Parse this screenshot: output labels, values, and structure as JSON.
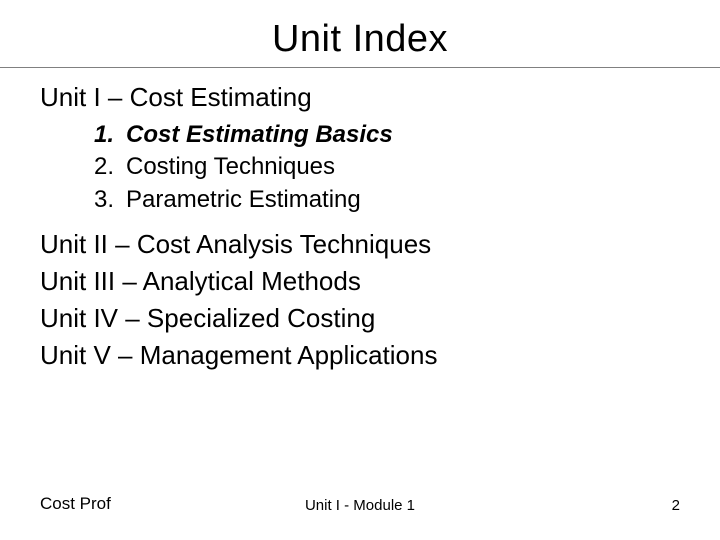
{
  "title": "Unit Index",
  "unit1": {
    "heading": "Unit I – Cost Estimating",
    "items": [
      {
        "num": "1.",
        "label": "Cost Estimating Basics",
        "highlighted": true
      },
      {
        "num": "2.",
        "label": "Costing Techniques",
        "highlighted": false
      },
      {
        "num": "3.",
        "label": "Parametric Estimating",
        "highlighted": false
      }
    ]
  },
  "other_units": [
    "Unit II – Cost Analysis Techniques",
    "Unit III – Analytical Methods",
    "Unit IV – Specialized Costing",
    "Unit V – Management Applications"
  ],
  "footer": {
    "left": "Cost Prof",
    "center": "Unit I - Module 1",
    "page": "2"
  }
}
